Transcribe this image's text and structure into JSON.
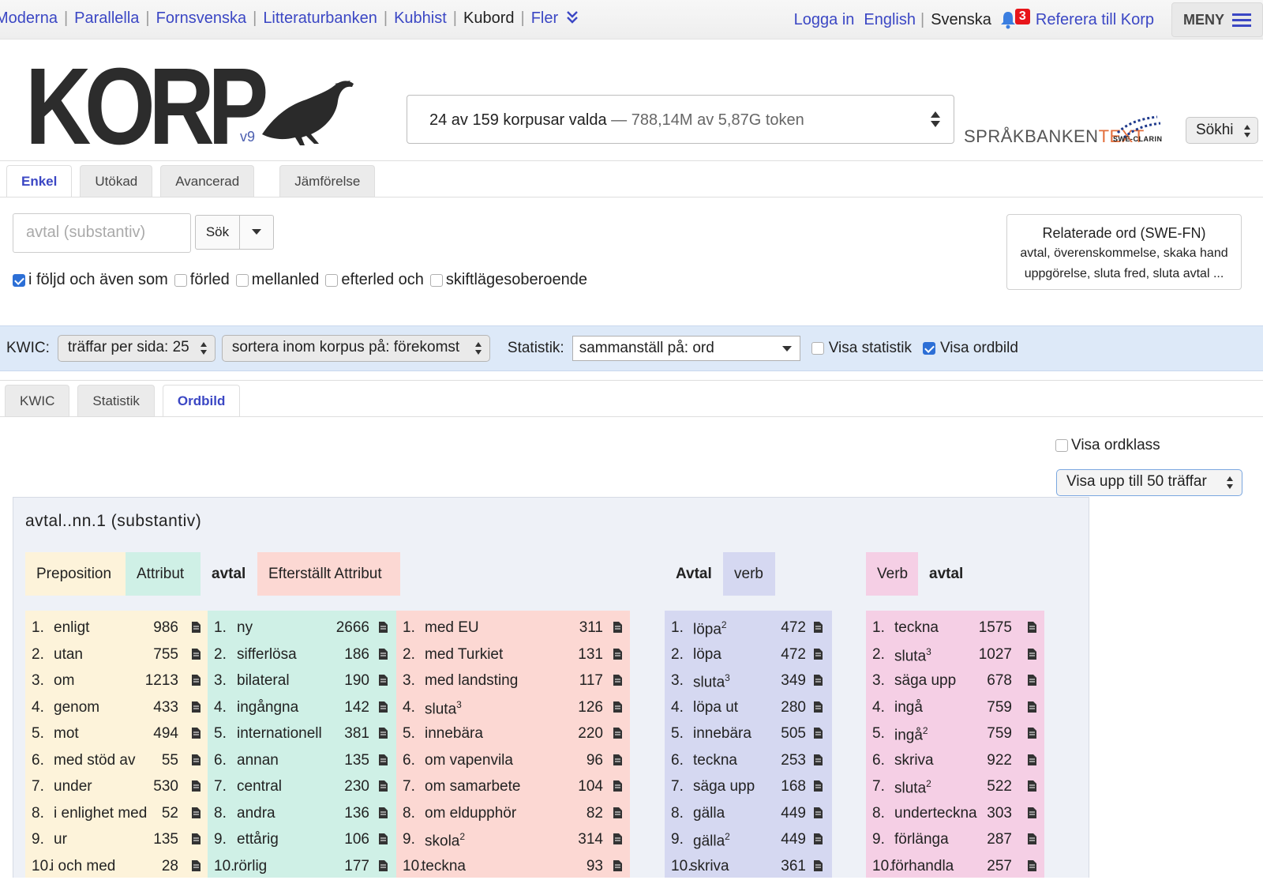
{
  "topnav": {
    "links": [
      "Moderna",
      "Parallella",
      "Fornsvenska",
      "Litteraturbanken",
      "Kubhist"
    ],
    "current": "Kubord",
    "more": "Fler"
  },
  "topright": {
    "login": "Logga in",
    "english": "English",
    "svenska": "Svenska",
    "notifications": "3",
    "cite": "Referera till Korp",
    "menu": "MENY"
  },
  "logo": {
    "text": "KORP",
    "version": "v9"
  },
  "corpus": {
    "selected": "24 av 159 korpusar valda",
    "tokens": "— 788,14M av 5,87G token"
  },
  "brand": {
    "part1": "SPRÅKBANKEN",
    "part2": "TEXT",
    "clarin": "SWE-CLARIN"
  },
  "sokhist": "Sökhi",
  "search_tabs": [
    "Enkel",
    "Utökad",
    "Avancerad",
    "Jämförelse"
  ],
  "search": {
    "placeholder": "avtal (substantiv)",
    "button": "Sök",
    "options": [
      {
        "label": "i följd och även som",
        "checked": true
      },
      {
        "label": "förled",
        "checked": false
      },
      {
        "label": "mellanled",
        "checked": false
      },
      {
        "label": "efterled och",
        "checked": false
      },
      {
        "label": "skiftlägesoberoende",
        "checked": false
      }
    ]
  },
  "related": {
    "title": "Relaterade ord (SWE-FN)",
    "line1": "avtal, överenskommelse, skaka hand",
    "line2": "uppgörelse, sluta fred, sluta avtal ..."
  },
  "kwicbar": {
    "kwic_label": "KWIC:",
    "per_page": "träffar per sida: 25",
    "sort": "sortera inom korpus på: förekomst",
    "stat_label": "Statistik:",
    "stat_select": "sammanställ på: ord",
    "show_stats": "Visa statistik",
    "show_wordpic": "Visa ordbild"
  },
  "result_tabs": [
    "KWIC",
    "Statistik",
    "Ordbild"
  ],
  "wordpicture": {
    "show_pos": "Visa ordklass",
    "limit": "Visa upp till 50 träffar",
    "title": "avtal..nn.1 (substantiv)",
    "headers": {
      "prep": "Preposition",
      "attr": "Attribut",
      "head1": "avtal",
      "post": "Efterställt Attribut",
      "head2": "Avtal",
      "verb1": "verb",
      "verb2": "Verb",
      "head3": "avtal"
    },
    "prep": [
      {
        "w": "enligt",
        "c": "986"
      },
      {
        "w": "utan",
        "c": "755"
      },
      {
        "w": "om",
        "c": "1213"
      },
      {
        "w": "genom",
        "c": "433"
      },
      {
        "w": "mot",
        "c": "494"
      },
      {
        "w": "med stöd av",
        "c": "55"
      },
      {
        "w": "under",
        "c": "530"
      },
      {
        "w": "i enlighet med",
        "c": "52"
      },
      {
        "w": "ur",
        "c": "135"
      },
      {
        "w": "i och med",
        "c": "28"
      }
    ],
    "attr": [
      {
        "w": "ny",
        "c": "2666"
      },
      {
        "w": "sifferlösa",
        "c": "186"
      },
      {
        "w": "bilateral",
        "c": "190"
      },
      {
        "w": "ingångna",
        "c": "142"
      },
      {
        "w": "internationell",
        "c": "381"
      },
      {
        "w": "annan",
        "c": "135"
      },
      {
        "w": "central",
        "c": "230"
      },
      {
        "w": "andra",
        "c": "136"
      },
      {
        "w": "ettårig",
        "c": "106"
      },
      {
        "w": "rörlig",
        "c": "177"
      }
    ],
    "post": [
      {
        "w": "med EU",
        "c": "311"
      },
      {
        "w": "med Turkiet",
        "c": "131"
      },
      {
        "w": "med landsting",
        "c": "117"
      },
      {
        "w": "sluta",
        "sup": "3",
        "c": "126"
      },
      {
        "w": "innebära",
        "c": "220"
      },
      {
        "w": "om vapenvila",
        "c": "96"
      },
      {
        "w": "om samarbete",
        "c": "104"
      },
      {
        "w": "om eldupphör",
        "c": "82"
      },
      {
        "w": "skola",
        "sup": "2",
        "c": "314"
      },
      {
        "w": "teckna",
        "c": "93"
      }
    ],
    "verb1": [
      {
        "w": "löpa",
        "sup": "2",
        "c": "472"
      },
      {
        "w": "löpa",
        "c": "472"
      },
      {
        "w": "sluta",
        "sup": "3",
        "c": "349"
      },
      {
        "w": "löpa ut",
        "c": "280"
      },
      {
        "w": "innebära",
        "c": "505"
      },
      {
        "w": "teckna",
        "c": "253"
      },
      {
        "w": "säga upp",
        "c": "168"
      },
      {
        "w": "gälla",
        "c": "449"
      },
      {
        "w": "gälla",
        "sup": "2",
        "c": "449"
      },
      {
        "w": "skriva",
        "c": "361"
      }
    ],
    "verb2": [
      {
        "w": "teckna",
        "c": "1575"
      },
      {
        "w": "sluta",
        "sup": "3",
        "c": "1027"
      },
      {
        "w": "säga upp",
        "c": "678"
      },
      {
        "w": "ingå",
        "c": "759"
      },
      {
        "w": "ingå",
        "sup": "2",
        "c": "759"
      },
      {
        "w": "skriva",
        "c": "922"
      },
      {
        "w": "sluta",
        "sup": "2",
        "c": "522"
      },
      {
        "w": "underteckna",
        "c": "303"
      },
      {
        "w": "förlänga",
        "c": "287"
      },
      {
        "w": "förhandla",
        "c": "257"
      }
    ]
  }
}
